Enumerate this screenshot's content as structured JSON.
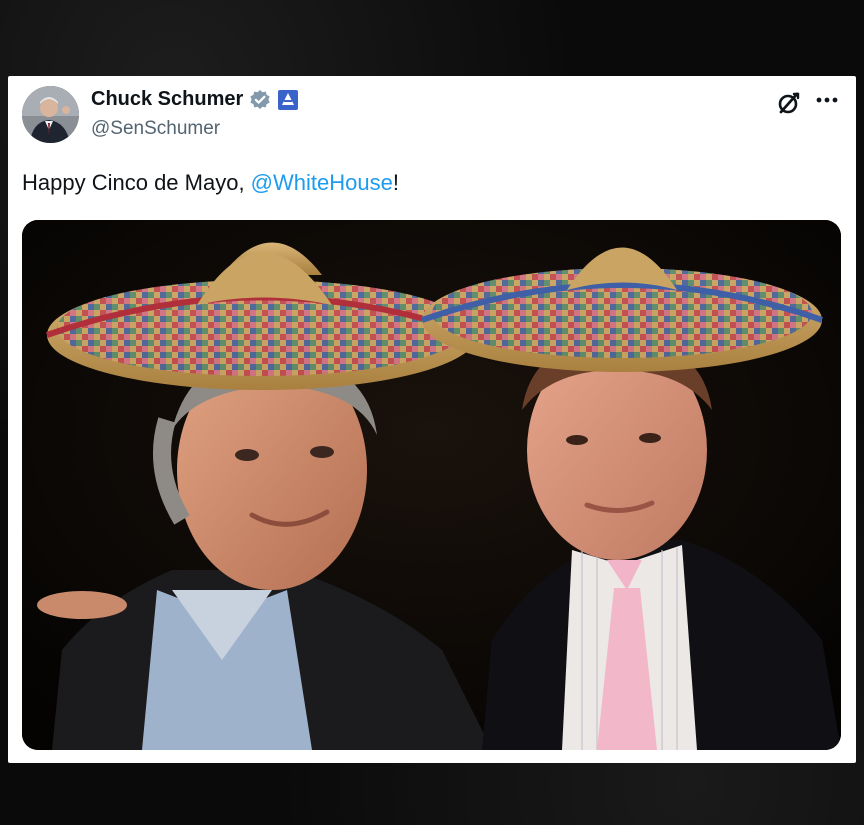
{
  "post": {
    "author": {
      "display_name": "Chuck Schumer",
      "handle": "@SenSchumer",
      "verified_icon": "verified-badge-icon",
      "affiliate_icon": "government-affiliate-icon"
    },
    "text_prefix": "Happy Cinco de Mayo, ",
    "mention": "@WhiteHouse",
    "text_suffix": "!",
    "actions": {
      "grok_icon": "grok-icon",
      "more_icon": "more-options-icon"
    },
    "media": {
      "description_icon": "photo"
    }
  },
  "colors": {
    "link": "#1d9bf0",
    "text": "#0f1419",
    "secondary_text": "#536471",
    "verified": "#829aab"
  }
}
